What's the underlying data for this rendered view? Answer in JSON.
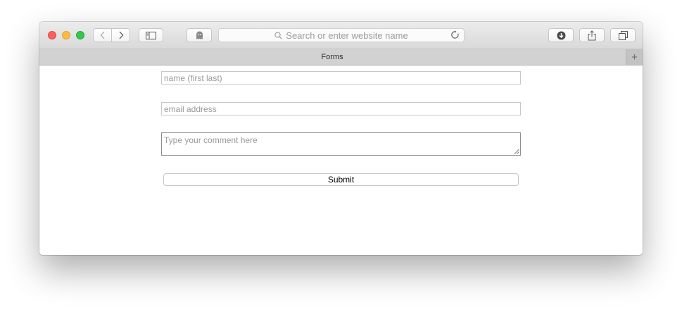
{
  "browser": {
    "address_placeholder": "Search or enter website name",
    "tab_title": "Forms",
    "new_tab_glyph": "+",
    "icons": [
      "close-window",
      "minimize-window",
      "zoom-window",
      "back-chevron",
      "forward-chevron",
      "sidebar",
      "ghostery",
      "search",
      "reload",
      "downloads",
      "share",
      "tabs-overview",
      "plus"
    ],
    "traffic_light_colors": {
      "close": "#fc605c",
      "minimize": "#fdbc40",
      "zoom": "#34c84a"
    }
  },
  "form": {
    "name_placeholder": "name (first last)",
    "email_placeholder": "email address",
    "comment_placeholder": "Type your comment here",
    "submit_label": "Submit"
  }
}
